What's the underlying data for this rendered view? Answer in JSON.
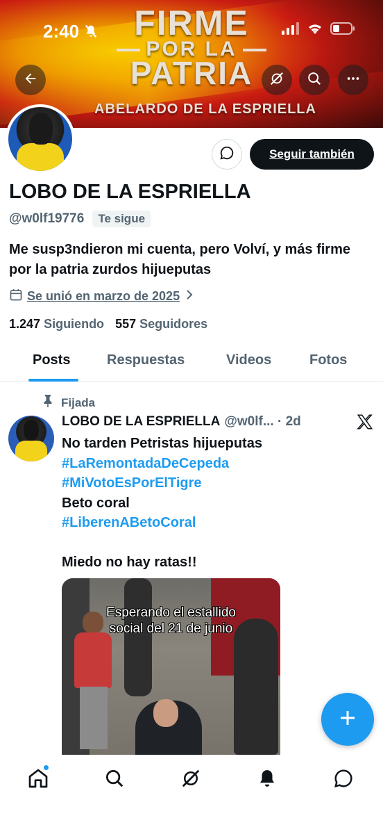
{
  "status_bar": {
    "time": "2:40"
  },
  "banner": {
    "line1": "FIRME",
    "line2": "POR LA",
    "line3": "PATRIA",
    "line4": "ABELARDO DE LA ESPRIELLA"
  },
  "profile": {
    "name": "LOBO DE LA ESPRIELLA",
    "handle": "@w0lf19776",
    "follows_you_badge": "Te sigue",
    "bio": "Me susp3ndieron mi cuenta, pero Volví, y más firme por la patria zurdos hijueputas",
    "joined": "Se unió en marzo de 2025",
    "following_count": "1.247",
    "following_label": "Siguiendo",
    "followers_count": "557",
    "followers_label": "Seguidores",
    "follow_button": "Seguir también"
  },
  "tabs": [
    {
      "label": "Posts",
      "active": true
    },
    {
      "label": "Respuestas",
      "active": false
    },
    {
      "label": "Videos",
      "active": false
    },
    {
      "label": "Fotos",
      "active": false
    }
  ],
  "post": {
    "pinned_label": "Fijada",
    "author_name": "LOBO DE LA ESPRIELLA",
    "author_meta": "@w0lf... · 2d",
    "text_line1": "No tarden Petristas hijueputas",
    "hashtag1": "#LaRemontadaDeCepeda",
    "hashtag2": "#MiVotoEsPorElTigre",
    "text_line2": "Beto coral",
    "hashtag3": "#LiberenABetoCoral",
    "text_line3": "Miedo no hay ratas!!",
    "media_caption_line1": "Esperando el estallido",
    "media_caption_line2": "social del 21 de junio"
  },
  "colors": {
    "accent": "#1d9bf0",
    "text_primary": "#0f1419",
    "text_secondary": "#536471"
  },
  "icons": {
    "back": "back-arrow-icon",
    "grok": "grok-icon",
    "search": "search-icon",
    "more": "more-icon",
    "message": "message-icon",
    "calendar": "calendar-icon",
    "pin": "pin-icon",
    "compose": "plus-icon",
    "nav": [
      "home-icon",
      "search-icon",
      "grok-icon",
      "bell-icon",
      "messages-icon"
    ]
  }
}
